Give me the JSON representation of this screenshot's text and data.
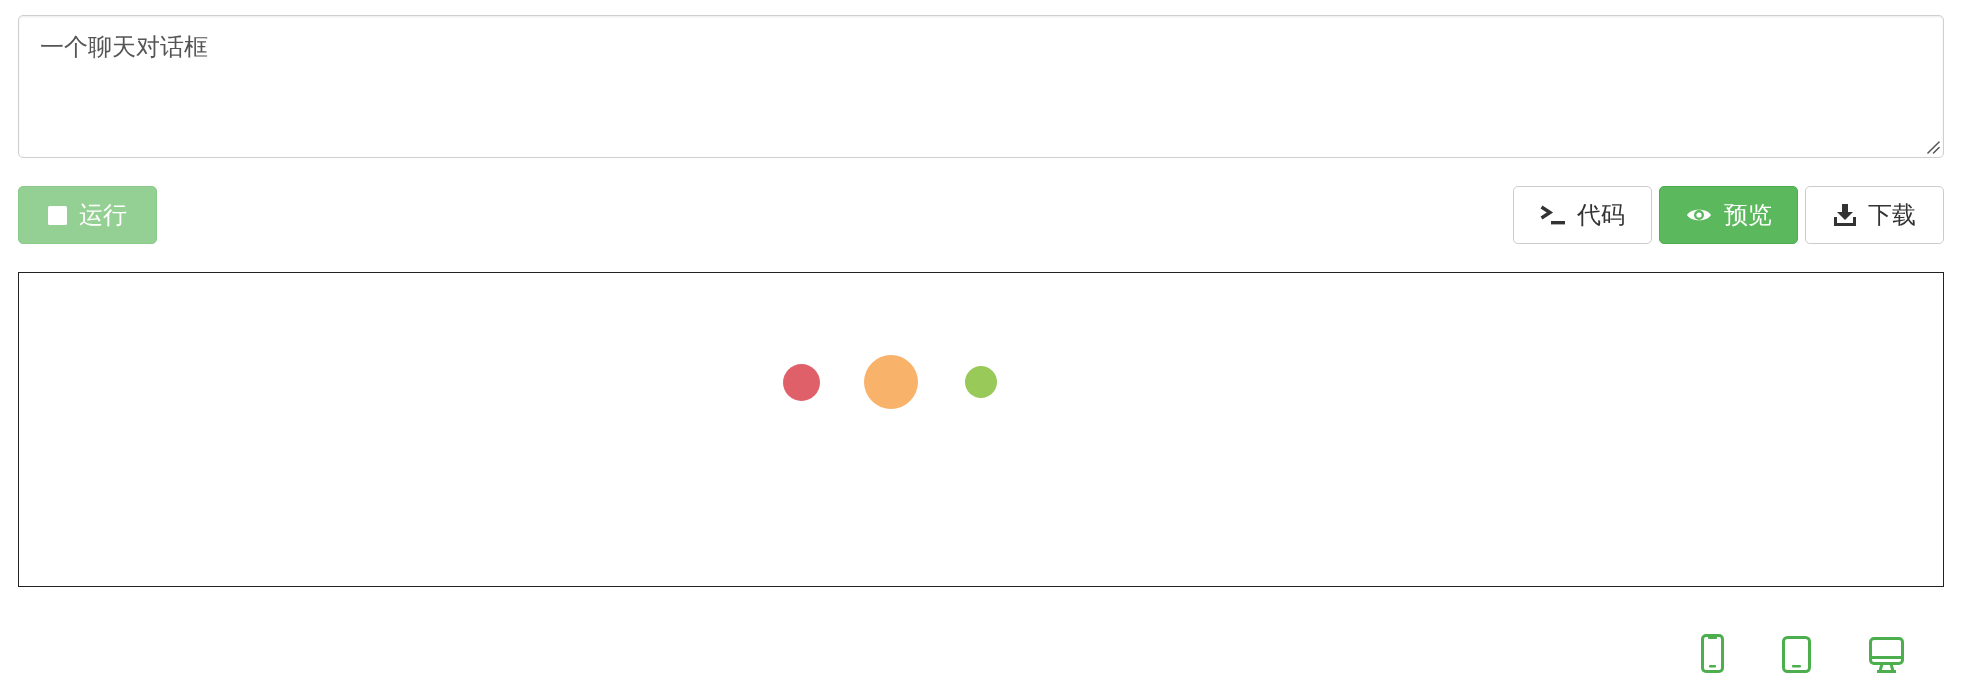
{
  "prompt": {
    "value": "一个聊天对话框"
  },
  "run_button": {
    "label": "运行",
    "disabled": true
  },
  "view_buttons": [
    {
      "kind": "code",
      "label": "代码",
      "selected": false
    },
    {
      "kind": "preview",
      "label": "预览",
      "selected": true
    }
  ],
  "download_button": {
    "label": "下载"
  },
  "preview": {
    "dots": [
      {
        "color": "#e0606a"
      },
      {
        "color": "#f8b26a"
      },
      {
        "color": "#99c959"
      }
    ]
  },
  "device_buttons": [
    {
      "kind": "phone"
    },
    {
      "kind": "tablet"
    },
    {
      "kind": "desktop"
    }
  ]
}
